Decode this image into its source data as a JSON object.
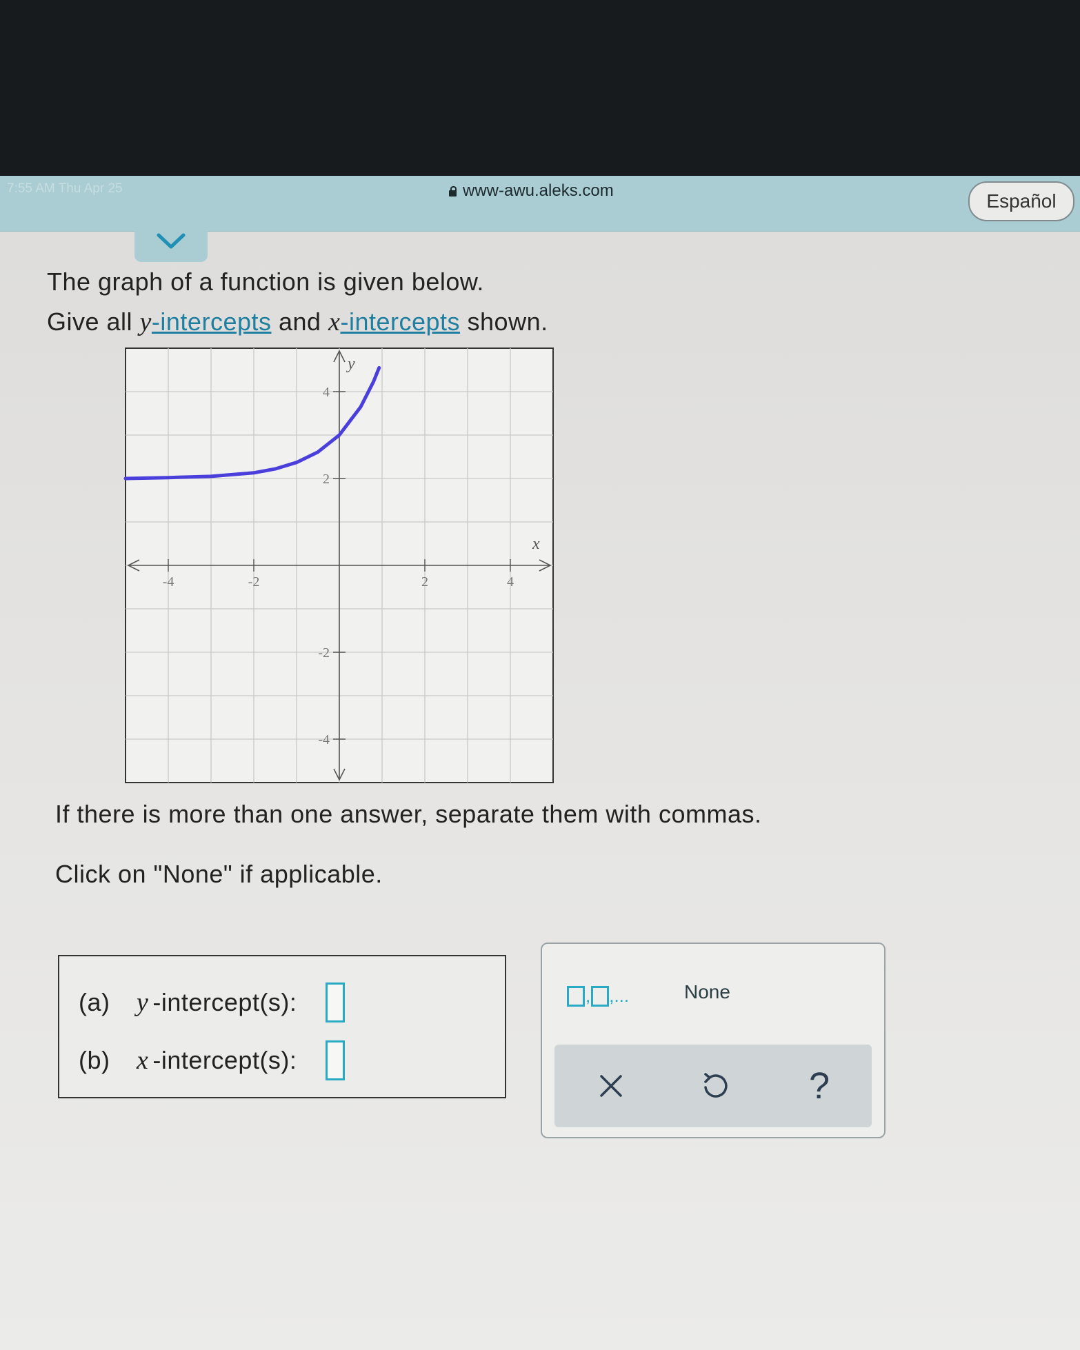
{
  "browser": {
    "status_time": "7:55 AM   Thu Apr 25",
    "url": "www-awu.aleks.com",
    "language_button": "Español"
  },
  "question": {
    "line1": "The graph of a function is given below.",
    "line2_pre": "Give all ",
    "y_var": "y",
    "y_link": "-intercepts",
    "middle": " and ",
    "x_var": "x",
    "x_link": "-intercepts",
    "line2_post": " shown.",
    "instruction1": "If there is more than one answer, separate them with commas.",
    "instruction2": "Click on \"None\" if applicable."
  },
  "answers": {
    "a_tag": "(a)",
    "a_var": "y",
    "a_label": "-intercept(s):",
    "a_value": "",
    "b_tag": "(b)",
    "b_var": "x",
    "b_label": "-intercept(s):",
    "b_value": ""
  },
  "tools": {
    "multi_suffix": ",...",
    "none_label": "None",
    "clear_icon": "x-icon",
    "undo_icon": "undo-icon",
    "help_label": "?"
  },
  "chart_data": {
    "type": "line",
    "title": "",
    "xlabel": "x",
    "ylabel": "y",
    "xlim": [
      -5,
      5
    ],
    "ylim": [
      -5,
      5
    ],
    "xticks": [
      -4,
      -2,
      2,
      4
    ],
    "yticks": [
      4,
      2,
      -2,
      -4
    ],
    "grid": true,
    "curve_color": "#4b3fdc",
    "series": [
      {
        "x": [
          -5,
          -4,
          -3,
          -2,
          -1.5,
          -1,
          -0.5,
          0,
          0.5,
          0.8,
          0.93
        ],
        "y": [
          2.0,
          2.02,
          2.05,
          2.13,
          2.22,
          2.37,
          2.61,
          3.0,
          3.65,
          4.23,
          4.55
        ]
      }
    ]
  },
  "colors": {
    "accent": "#2aa9c4",
    "link": "#1f7fa0",
    "url_bar": "#a9cdd3"
  }
}
